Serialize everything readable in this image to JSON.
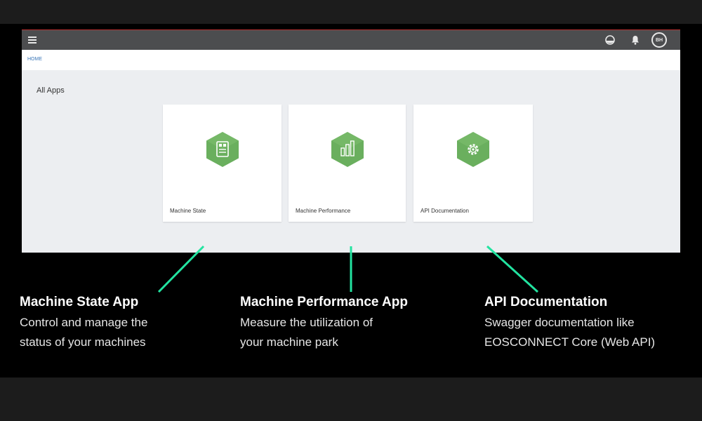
{
  "header": {
    "avatar_initials": "BH"
  },
  "breadcrumb": {
    "home": "HOME"
  },
  "main": {
    "section_title": "All Apps",
    "cards": [
      {
        "label": "Machine State",
        "icon": "machine-state-icon"
      },
      {
        "label": "Machine Performance",
        "icon": "bar-chart-icon"
      },
      {
        "label": "API Documentation",
        "icon": "gear-icon"
      }
    ]
  },
  "callouts": [
    {
      "title": "Machine State App",
      "desc_line1": "Control and manage the",
      "desc_line2": "status of your machines"
    },
    {
      "title": "Machine Performance App",
      "desc_line1": "Measure the utilization of",
      "desc_line2": "your machine park"
    },
    {
      "title": "API Documentation",
      "desc_line1": "Swagger documentation like",
      "desc_line2": "EOSCONNECT Core (Web API)"
    }
  ],
  "colors": {
    "accent_green": "#22e3a0",
    "hex_fill": "#6aaf5e",
    "topbar": "#4c4d4f",
    "link": "#3a76b8"
  }
}
